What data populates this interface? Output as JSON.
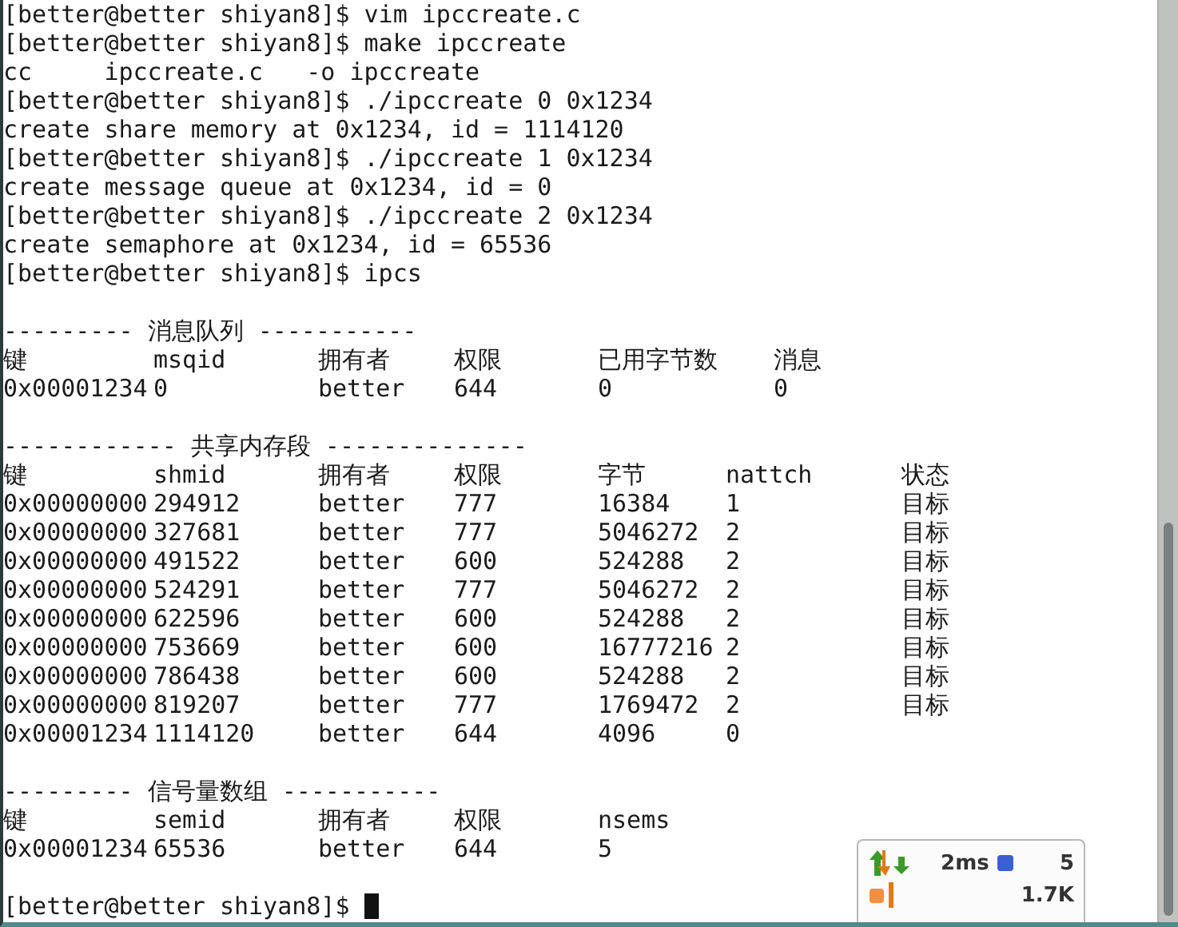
{
  "terminal": {
    "lines": [
      "[better@better shiyan8]$ vim ipccreate.c",
      "[better@better shiyan8]$ make ipccreate",
      "cc     ipccreate.c   -o ipccreate",
      "[better@better shiyan8]$ ./ipccreate 0 0x1234",
      "create share memory at 0x1234, id = 1114120",
      "[better@better shiyan8]$ ./ipccreate 1 0x1234",
      "create message queue at 0x1234, id = 0",
      "[better@better shiyan8]$ ./ipccreate 2 0x1234",
      "create semaphore at 0x1234, id = 65536",
      "[better@better shiyan8]$ ipcs"
    ],
    "sections": [
      {
        "title": "--------- 消息队列 -----------",
        "columns": [
          "键",
          "msqid",
          "拥有者",
          "权限",
          "已用字节数",
          "消息"
        ],
        "rows": [
          [
            "0x00001234",
            "0",
            "better",
            "644",
            "0",
            "0"
          ]
        ]
      },
      {
        "title": "------------ 共享内存段 --------------",
        "columns": [
          "键",
          "shmid",
          "拥有者",
          "权限",
          "字节",
          "nattch",
          "状态"
        ],
        "rows": [
          [
            "0x00000000",
            "294912",
            "better",
            "777",
            "16384",
            "1",
            "目标"
          ],
          [
            "0x00000000",
            "327681",
            "better",
            "777",
            "5046272",
            "2",
            "目标"
          ],
          [
            "0x00000000",
            "491522",
            "better",
            "600",
            "524288",
            "2",
            "目标"
          ],
          [
            "0x00000000",
            "524291",
            "better",
            "777",
            "5046272",
            "2",
            "目标"
          ],
          [
            "0x00000000",
            "622596",
            "better",
            "600",
            "524288",
            "2",
            "目标"
          ],
          [
            "0x00000000",
            "753669",
            "better",
            "600",
            "16777216",
            "2",
            "目标"
          ],
          [
            "0x00000000",
            "786438",
            "better",
            "600",
            "524288",
            "2",
            "目标"
          ],
          [
            "0x00000000",
            "819207",
            "better",
            "777",
            "1769472",
            "2",
            "目标"
          ],
          [
            "0x00001234",
            "1114120",
            "better",
            "644",
            "4096",
            "0",
            ""
          ]
        ]
      },
      {
        "title": "--------- 信号量数组 -----------",
        "columns": [
          "键",
          "semid",
          "拥有者",
          "权限",
          "nsems"
        ],
        "rows": [
          [
            "0x00001234",
            "65536",
            "better",
            "644",
            "5"
          ]
        ]
      }
    ],
    "prompt": "[better@better shiyan8]$"
  },
  "monitor": {
    "latency": "2ms",
    "count": "5",
    "rate": "1.7K"
  }
}
